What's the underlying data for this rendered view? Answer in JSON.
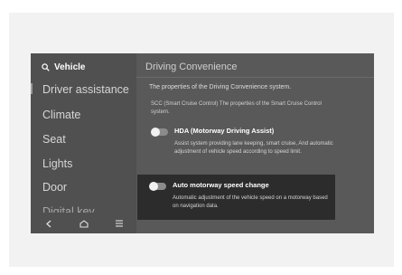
{
  "sidebar": {
    "header": "Vehicle",
    "items": [
      "Driver assistance",
      "Climate",
      "Seat",
      "Lights",
      "Door",
      "Digital key"
    ],
    "bottom_icons": [
      "back-icon",
      "home-icon",
      "menu-icon"
    ]
  },
  "content": {
    "title": "Driving Convenience",
    "description": "The properties of the Driving Convenience system.",
    "note": "SCC (Smart Cruise Control) The properties of the Smart Cruise Control system.",
    "options": [
      {
        "title": "HDA (Motorway Driving Assist)",
        "description": "Assist system providing lane keeping, smart cruise, And automatic adjustment of vehicle speed according to speed limit."
      },
      {
        "title": "Auto motorway speed change",
        "description": "Automatic adjustment of the vehicle speed on a motorway based on navigation data."
      }
    ]
  },
  "colors": {
    "screen_bg": "#595959",
    "sidebar_bg": "#505050",
    "selected_bg": "#2c2c2c"
  }
}
